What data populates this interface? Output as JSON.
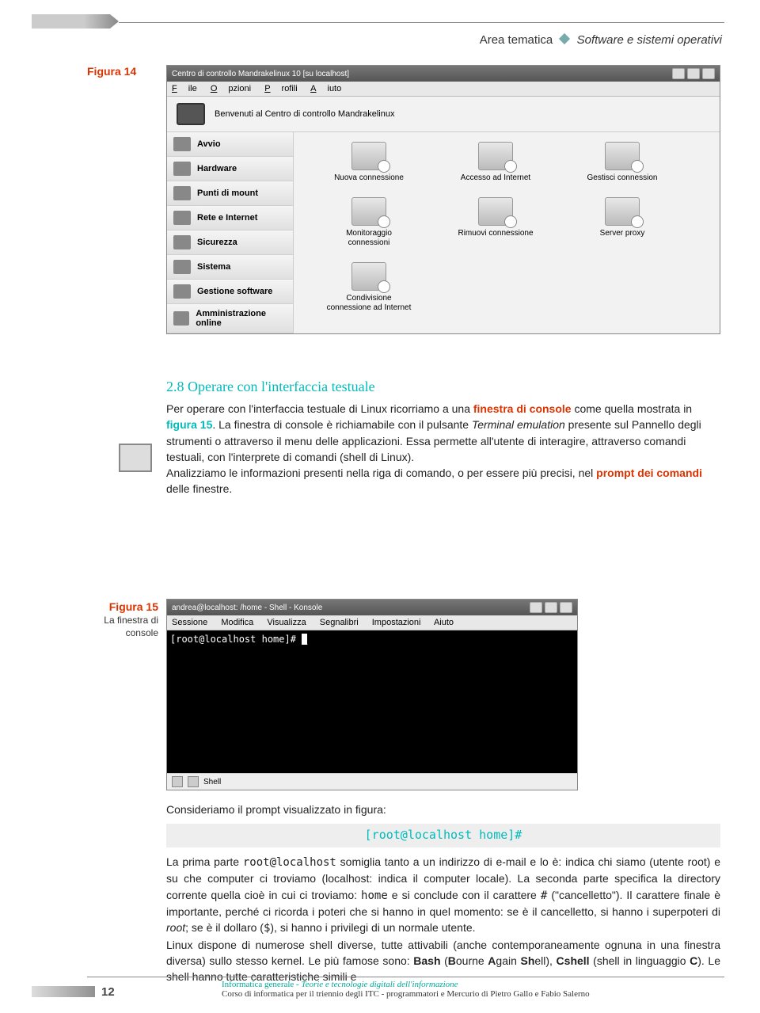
{
  "header": {
    "area": "Area tematica",
    "topic": "Software e sistemi operativi"
  },
  "figures": {
    "f14": "Figura 14",
    "f15": "Figura 15",
    "f15_sub": "La finestra di console"
  },
  "mcc": {
    "title": "Centro di controllo Mandrakelinux 10 [su localhost]",
    "menu": {
      "file": "File",
      "opzioni": "Opzioni",
      "profili": "Profili",
      "aiuto": "Aiuto"
    },
    "welcome": "Benvenuti al Centro di controllo Mandrakelinux",
    "sidebar": {
      "avvio": "Avvio",
      "hardware": "Hardware",
      "mount": "Punti di mount",
      "rete": "Rete e Internet",
      "sicurezza": "Sicurezza",
      "sistema": "Sistema",
      "software": "Gestione software",
      "admin": "Amministrazione online"
    },
    "icons": {
      "r1": {
        "a": "Nuova connessione",
        "b": "Accesso ad Internet",
        "c": "Gestisci connession"
      },
      "r2": {
        "a": "Monitoraggio connessioni",
        "b": "Rimuovi connessione",
        "c": "Server proxy"
      },
      "r3": {
        "a": "Condivisione connessione ad Internet"
      }
    }
  },
  "section": {
    "title": "2.8 Operare con l'interfaccia testuale"
  },
  "p1": {
    "t1": "Per operare con l'interfaccia testuale di Linux ricorriamo a una ",
    "t2": "finestra di console",
    "t3": " come quella mostrata in ",
    "t4": "figura 15",
    "t5": ". La finestra di console è richiamabile con il pulsante ",
    "t6": "Terminal emulation",
    "t7": " presente sul Pannello degli strumenti o attraverso il menu delle applicazioni. Essa permette all'utente di interagire, attraverso comandi testuali, con l'interprete di comandi (shell di Linux).",
    "t8": "Analizziamo le informazioni presenti nella riga di comando, o per essere più precisi, nel ",
    "t9": "prompt dei comandi",
    "t10": " delle finestre."
  },
  "konsole": {
    "title": "andrea@localhost: /home - Shell - Konsole",
    "menu": {
      "sessione": "Sessione",
      "modifica": "Modifica",
      "visualizza": "Visualizza",
      "segnalibri": "Segnalibri",
      "impostazioni": "Impostazioni",
      "aiuto": "Aiuto"
    },
    "prompt": "[root@localhost home]#",
    "tab": "Shell"
  },
  "p2": {
    "intro": "Consideriamo il prompt visualizzato in figura:",
    "cmd": "[root@localhost home]#",
    "t1": "La prima parte ",
    "c1": "root@localhost",
    "t2": " somiglia tanto a un indirizzo di e-mail e lo è: indica chi siamo (utente root) e su che computer ci troviamo (localhost: indica il computer locale). La seconda parte specifica la directory corrente quella cioè in cui ci troviamo: ",
    "c2": "home",
    "t3": " e si conclude con il carattere ",
    "c3": "#",
    "t4": " (\"cancelletto\"). Il carattere finale è importante, perché ci ricorda i poteri che si hanno in quel momento: se è il cancelletto, si hanno i superpoteri di ",
    "i1": "root",
    "t5": "; se è il dollaro (",
    "c4": "$",
    "t6": "), si hanno i privilegi di un normale utente.",
    "t7": "Linux dispone di numerose shell diverse, tutte attivabili (anche contemporaneamente ognuna in una finestra diversa) sullo stesso kernel. Le più famose sono: ",
    "bash": "Bash",
    "b2": " (",
    "b_b": "B",
    "b3": "ourne ",
    "b_a": "A",
    "b4": "gain ",
    "b_sh": "Sh",
    "b5": "ell), ",
    "csh": "Cshell",
    "c5": " (shell in linguaggio ",
    "b_c": "C",
    "c6": "). Le shell hanno tutte caratteristiche simili e"
  },
  "footer": {
    "page": "12",
    "l1a": "Informatica generale - ",
    "l1b": "Teorie e tecnologie digitali dell'informazione",
    "l2": "Corso di informatica per il triennio degli ITC - programmatori e Mercurio di Pietro Gallo e Fabio Salerno"
  }
}
